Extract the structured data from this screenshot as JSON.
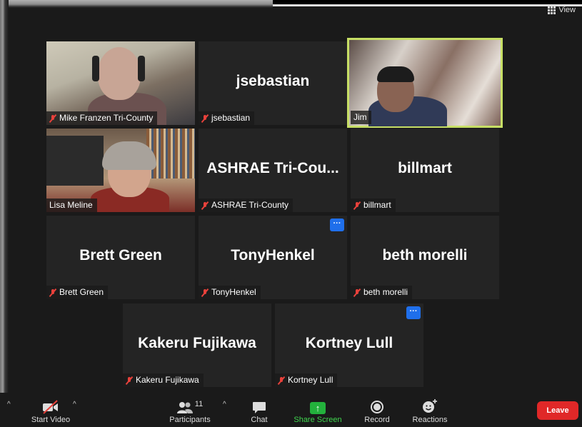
{
  "header": {
    "view_label": "View"
  },
  "tiles": [
    {
      "name": "Mike Franzen Tri-County",
      "big": ""
    },
    {
      "name": "jsebastian",
      "big": "jsebastian"
    },
    {
      "name": "Jim",
      "big": ""
    },
    {
      "name": "Lisa Meline",
      "big": ""
    },
    {
      "name": "ASHRAE Tri-County",
      "big": "ASHRAE  Tri-Cou..."
    },
    {
      "name": "billmart",
      "big": "billmart"
    },
    {
      "name": "Brett Green",
      "big": "Brett Green"
    },
    {
      "name": "TonyHenkel",
      "big": "TonyHenkel"
    },
    {
      "name": "beth morelli",
      "big": "beth morelli"
    },
    {
      "name": "Kakeru Fujikawa",
      "big": "Kakeru Fujikawa"
    },
    {
      "name": "Kortney Lull",
      "big": "Kortney Lull"
    }
  ],
  "more_menu_label": "···",
  "toolbar": {
    "start_video": "Start Video",
    "participants": "Participants",
    "participants_count": "11",
    "chat": "Chat",
    "share_screen": "Share Screen",
    "record": "Record",
    "reactions": "Reactions",
    "leave": "Leave"
  },
  "colors": {
    "accent_active": "#c6e159",
    "share_green": "#23b13c",
    "leave_red": "#e02828",
    "muted_red": "#e8413b",
    "menu_blue": "#1f6feb"
  }
}
